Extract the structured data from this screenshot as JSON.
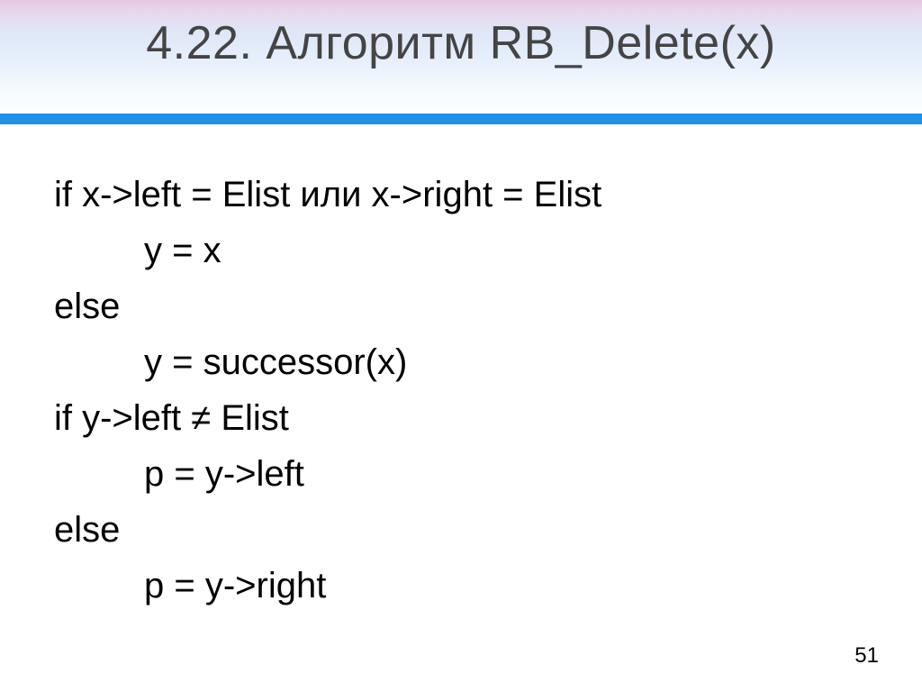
{
  "title": "4.22. Алгоритм RB_Delete(x)",
  "code": {
    "l1": "if x->left = Elist или x->right = Elist",
    "l2": "y = x",
    "l3": "else",
    "l4": "y = successor(x)",
    "l5": "if y->left ≠ Elist",
    "l6": "p = y->left",
    "l7": "else",
    "l8": "p = y->right"
  },
  "page_number": "51"
}
